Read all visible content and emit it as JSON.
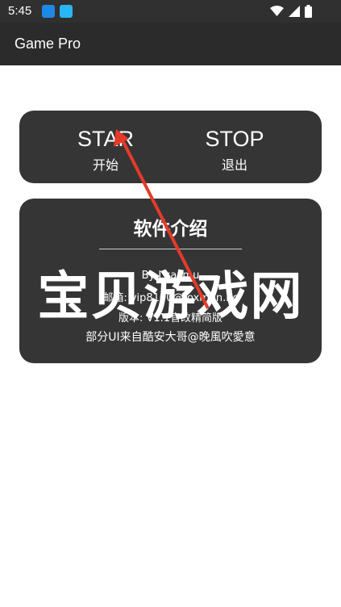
{
  "status_bar": {
    "time": "5:45",
    "icons": [
      "download-icon",
      "app-notification-icon",
      "wifi-icon",
      "signal-icon",
      "battery-icon"
    ]
  },
  "app_bar": {
    "title": "Game Pro"
  },
  "controls": {
    "start": {
      "label_en": "STAR",
      "label_zh": "开始"
    },
    "stop": {
      "label_en": "STOP",
      "label_zh": "退出"
    }
  },
  "intro": {
    "title": "软件介绍",
    "lines": [
      "By Lxacmu",
      "邮箱: vip8100@foxmon.nc",
      "版本: V1.1官改精简版",
      "部分UI来自酷安大哥@晚風吹愛意"
    ]
  },
  "watermark": "宝贝游戏网",
  "colors": {
    "status_bar": "#303030",
    "app_bar": "#2b2b2b",
    "card": "#353535",
    "annotation_arrow": "#e53a2a"
  }
}
